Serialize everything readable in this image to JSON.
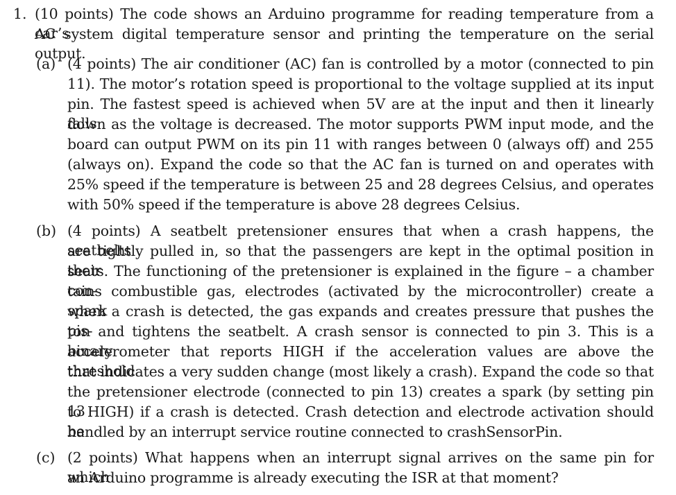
{
  "question": {
    "number": "1.",
    "lines": [
      "(10 points) The code shows an Arduino programme for reading temperature from a car’s",
      "AC system digital temperature sensor and printing the temperature on the serial output."
    ]
  },
  "parts": [
    {
      "label": "(a)",
      "lines": [
        "(4 points) The air conditioner (AC) fan is controlled by a motor (connected to pin",
        "11). The motor’s rotation speed is proportional to the voltage supplied at its input",
        "pin. The fastest speed is achieved when 5V are at the input and then it linearly falls",
        "down as the voltage is decreased. The motor supports PWM input mode, and the",
        "board can output PWM on its pin 11 with ranges between 0 (always off) and 255",
        "(always on). Expand the code so that the AC fan is turned on and operates with",
        "25% speed if the temperature is between 25 and 28 degrees Celsius, and operates",
        "with 50% speed if the temperature is above 28 degrees Celsius."
      ]
    },
    {
      "label": "(b)",
      "lines": [
        "(4 points) A seatbelt pretensioner ensures that when a crash happens, the seatbelts",
        "are tightly pulled in, so that the passengers are kept in the optimal position in their",
        "seats. The functioning of the pretensioner is explained in the figure – a chamber con-",
        "tains combustible gas, electrodes (activated by the microcontroller) create a spark",
        "when a crash is detected, the gas expands and creates pressure that pushes the pis-",
        "ton and tightens the seatbelt. A crash sensor is connected to pin 3. This is a binary",
        "accelerometer that reports HIGH if the acceleration values are above the threshold",
        "that indicates a very sudden change (most likely a crash). Expand the code so that",
        "the pretensioner electrode (connected to pin 13) creates a spark (by setting pin 13",
        "to HIGH) if a crash is detected. Crash detection and electrode activation should be",
        "handled by an interrupt service routine connected to crashSensorPin."
      ]
    },
    {
      "label": "(c)",
      "lines": [
        "(2 points) What happens when an interrupt signal arrives on the same pin for which",
        "an Arduino programme is already executing the ISR at that moment?"
      ]
    }
  ]
}
